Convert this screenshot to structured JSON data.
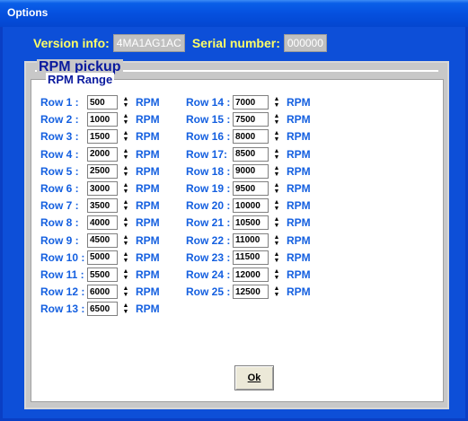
{
  "window": {
    "title": "Options"
  },
  "info": {
    "version_label": "Version info:",
    "version_value": "4MA1AG1AC",
    "serial_label": "Serial number:",
    "serial_value": "000000"
  },
  "rpm_pickup": {
    "title": "RPM pickup"
  },
  "rpm_range": {
    "title": "RPM Range",
    "unit": "RPM",
    "rows": [
      {
        "label": "Row  1 :",
        "value": "500"
      },
      {
        "label": "Row  2 :",
        "value": "1000"
      },
      {
        "label": "Row  3 :",
        "value": "1500"
      },
      {
        "label": "Row  4 :",
        "value": "2000"
      },
      {
        "label": "Row  5 :",
        "value": "2500"
      },
      {
        "label": "Row  6 :",
        "value": "3000"
      },
      {
        "label": "Row  7 :",
        "value": "3500"
      },
      {
        "label": "Row  8 :",
        "value": "4000"
      },
      {
        "label": "Row  9 :",
        "value": "4500"
      },
      {
        "label": "Row 10 :",
        "value": "5000"
      },
      {
        "label": "Row 11 :",
        "value": "5500"
      },
      {
        "label": "Row 12 :",
        "value": "6000"
      },
      {
        "label": "Row 13 :",
        "value": "6500"
      },
      {
        "label": "Row 14 :",
        "value": "7000"
      },
      {
        "label": "Row 15 :",
        "value": "7500"
      },
      {
        "label": "Row 16 :",
        "value": "8000"
      },
      {
        "label": "Row 17:",
        "value": "8500"
      },
      {
        "label": "Row 18 :",
        "value": "9000"
      },
      {
        "label": "Row 19 :",
        "value": "9500"
      },
      {
        "label": "Row 20 :",
        "value": "10000"
      },
      {
        "label": "Row 21 :",
        "value": "10500"
      },
      {
        "label": "Row 22 :",
        "value": "11000"
      },
      {
        "label": "Row 23 :",
        "value": "11500"
      },
      {
        "label": "Row 24 :",
        "value": "12000"
      },
      {
        "label": "Row 25 :",
        "value": "12500"
      }
    ]
  },
  "ok_button": {
    "label": "Ok"
  }
}
